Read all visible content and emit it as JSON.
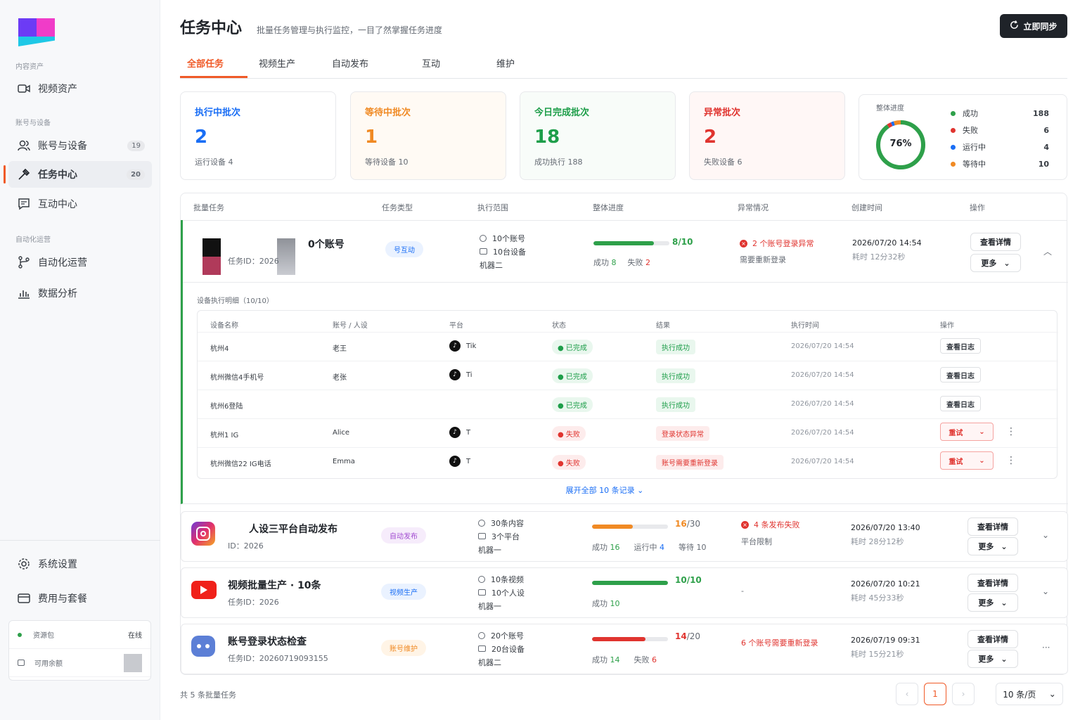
{
  "sidebar": {
    "sections": {
      "content": "内容资产",
      "accounts": "账号与设备",
      "auto": "自动化运营"
    },
    "items": [
      {
        "label": "视频资产",
        "icon": "video-icon"
      },
      {
        "label": "账号与设备",
        "badge": "19",
        "icon": "users-icon"
      },
      {
        "label": "任务中心",
        "badge": "20",
        "icon": "task-icon"
      },
      {
        "label": "互动中心",
        "icon": "chat-icon"
      },
      {
        "label": "自动化运营",
        "icon": "flow-icon"
      },
      {
        "label": "数据分析",
        "icon": "chart-icon"
      }
    ],
    "bottom": [
      {
        "label": "系统设置",
        "icon": "gear-icon"
      },
      {
        "label": "费用与套餐",
        "icon": "wallet-icon"
      }
    ],
    "resource": {
      "label": "资源包",
      "online": "在线",
      "credit": "可用余额"
    }
  },
  "header": {
    "title": "任务中心",
    "subtitle": "批量任务管理与执行监控，一目了然掌握任务进度",
    "sync": "立即同步"
  },
  "tabs": [
    "全部任务",
    "视频生产",
    "自动发布",
    "互动",
    "维护"
  ],
  "stats": [
    {
      "title": "执行中批次",
      "value": "2",
      "sub": "运行设备 4",
      "color": "#1a6ef5",
      "bg": "#ffffff"
    },
    {
      "title": "等待中批次",
      "value": "1",
      "sub": "等待设备 10",
      "color": "#f08a24",
      "bg": "#fffaf4"
    },
    {
      "title": "今日完成批次",
      "value": "18",
      "sub": "成功执行 188",
      "color": "#1e9e4a",
      "bg": "#f8fcf9"
    },
    {
      "title": "异常批次",
      "value": "2",
      "sub": "失败设备 6",
      "color": "#e0342f",
      "bg": "#fff7f6"
    }
  ],
  "progress": {
    "title": "整体进度",
    "percent": "76%",
    "percent_value": 76,
    "legend": [
      {
        "label": "成功",
        "value": "188",
        "color": "#2ea04a"
      },
      {
        "label": "失败",
        "value": "6",
        "color": "#e0342f"
      },
      {
        "label": "运行中",
        "value": "4",
        "color": "#1a6ef5"
      },
      {
        "label": "等待中",
        "value": "10",
        "color": "#f08a24"
      }
    ]
  },
  "table": {
    "headers": [
      "批量任务",
      "任务类型",
      "执行范围",
      "整体进度",
      "异常情况",
      "创建时间",
      "操作"
    ],
    "detail_btn": "查看详情",
    "more_btn": "更多",
    "rows": [
      {
        "title": "0个账号",
        "id_label": "任务ID：",
        "id": "2026",
        "type": "号互动",
        "scope": [
          "10个账号",
          "10台设备",
          "机器二"
        ],
        "progress_text": "8/10",
        "progress_value": 0.8,
        "bar_color": "#2ea04a",
        "stats": [
          [
            "成功",
            "8",
            "#2ea04a"
          ],
          [
            "失败",
            "2",
            "#e0342f"
          ]
        ],
        "issue": "2 个账号登录异常",
        "issue_sub": "需要重新登录",
        "created": "2026/07/20 14:54",
        "duration": "耗时 12分32秒"
      },
      {
        "title": "人设三平台自动发布",
        "id_label": "ID：",
        "id": "2026",
        "type": "自动发布",
        "scope": [
          "30条内容",
          "3个平台",
          "机器一"
        ],
        "progress_num": "16",
        "progress_den": "/30",
        "progress_value": 0.533,
        "bar_color": "#f08a24",
        "stats": [
          [
            "成功",
            "16",
            "#2ea04a"
          ],
          [
            "运行中",
            "4",
            "#1a6ef5"
          ],
          [
            "等待",
            "10",
            "#646a73"
          ]
        ],
        "issue": "4 条发布失败",
        "issue_sub": "平台限制",
        "created": "2026/07/20 13:40",
        "duration": "耗时 28分12秒"
      },
      {
        "title": "视频批量生产 · 10条",
        "id_label": "任务ID：",
        "id": "2026",
        "type": "视频生产",
        "scope": [
          "10条视频",
          "10个人设",
          "机器一"
        ],
        "progress_text": "10/10",
        "progress_value": 1,
        "bar_color": "#2ea04a",
        "stats": [
          [
            "成功",
            "10",
            "#2ea04a"
          ]
        ],
        "issue": "-",
        "issue_sub": "",
        "created": "2026/07/20 10:21",
        "duration": "耗时 45分33秒"
      },
      {
        "title": "账号登录状态检查",
        "id_label": "任务ID：",
        "id": "20260719093155",
        "type": "账号维护",
        "scope": [
          "20个账号",
          "20台设备",
          "机器二"
        ],
        "progress_num": "14",
        "progress_den": "/20",
        "progress_value": 0.7,
        "bar_color": "#e0342f",
        "stats": [
          [
            "成功",
            "14",
            "#2ea04a"
          ],
          [
            "失败",
            "6",
            "#e0342f"
          ]
        ],
        "issue": "6 个账号需要重新登录",
        "issue_sub": "",
        "created": "2026/07/19 09:31",
        "duration": "耗时 15分21秒"
      }
    ],
    "detail": {
      "title": "设备执行明细（10/10）",
      "headers": [
        "设备名称",
        "账号 / 人设",
        "平台",
        "状态",
        "结果",
        "执行时间",
        "操作"
      ],
      "rows": [
        {
          "device": "杭州4",
          "account": "老王",
          "platform": "Tik",
          "status": "已完成",
          "result": "执行成功",
          "time": "2026/07/20 14:54",
          "op": "查看日志",
          "ok": true
        },
        {
          "device": "杭州微信4手机号",
          "account": "老张",
          "platform": "Ti",
          "status": "已完成",
          "result": "执行成功",
          "time": "2026/07/20 14:54",
          "op": "查看日志",
          "ok": true
        },
        {
          "device": "杭州6登陆",
          "account": "",
          "platform": "",
          "status": "已完成",
          "result": "执行成功",
          "time": "2026/07/20 14:54",
          "op": "查看日志",
          "ok": true
        },
        {
          "device": "杭州1 IG",
          "account": "Alice",
          "platform": "T",
          "status": "失败",
          "result": "登录状态异常",
          "time": "2026/07/20 14:54",
          "op": "重试",
          "ok": false
        },
        {
          "device": "杭州微信22 IG电话",
          "account": "Emma",
          "platform": "T",
          "status": "失败",
          "result": "账号需要重新登录",
          "time": "2026/07/20 14:54",
          "op": "重试",
          "ok": false
        }
      ],
      "expand": "展开全部 10 条记录"
    }
  },
  "footer": {
    "total": "共 5 条批量任务",
    "page": "1",
    "page_size": "10 条/页"
  }
}
